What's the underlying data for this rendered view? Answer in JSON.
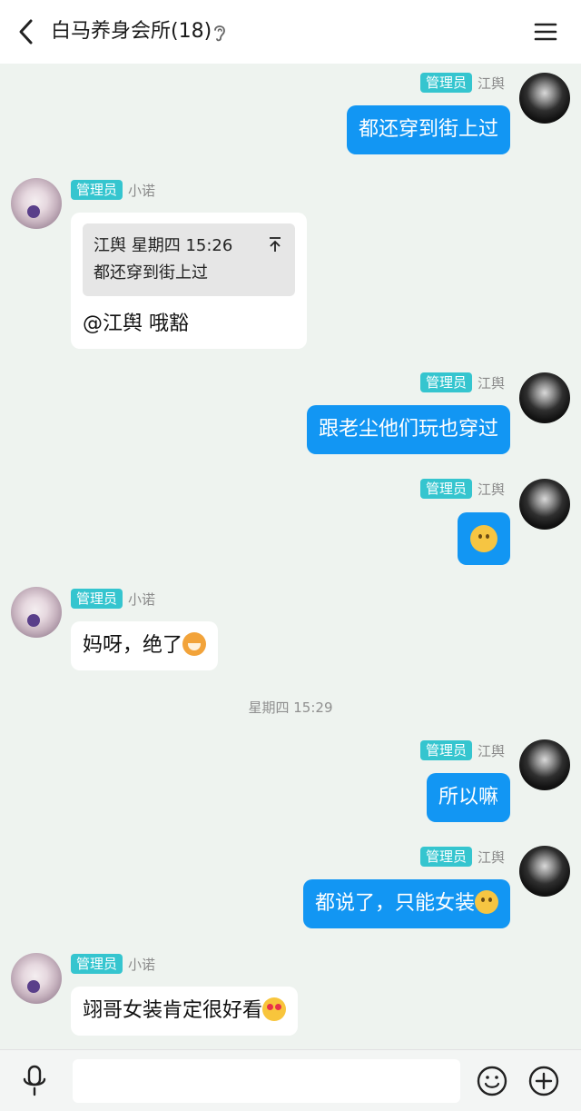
{
  "header": {
    "title": "白马养身会所(18)",
    "back_icon": "chevron-left-icon",
    "ear_icon": "ear-icon",
    "menu_icon": "hamburger-menu-icon"
  },
  "messages": [
    {
      "side": "right",
      "badge": "管理员",
      "name": "江舆",
      "text": "都还穿到街上过"
    },
    {
      "side": "left",
      "badge": "管理员",
      "name": "小诺",
      "quote_header": "江舆 星期四 15:26",
      "quote_text": "都还穿到街上过",
      "text": "@江舆 哦豁"
    },
    {
      "side": "right",
      "badge": "管理员",
      "name": "江舆",
      "text": "跟老尘他们玩也穿过"
    },
    {
      "side": "right",
      "badge": "管理员",
      "name": "江舆",
      "emoji": "smiling-face-emoji"
    },
    {
      "side": "left",
      "badge": "管理员",
      "name": "小诺",
      "text": "妈呀，绝了",
      "emoji": "dog-face-emoji"
    },
    {
      "side": "right",
      "badge": "管理员",
      "name": "江舆",
      "text": "所以嘛"
    },
    {
      "side": "right",
      "badge": "管理员",
      "name": "江舆",
      "text": "都说了，只能女装",
      "emoji": "smiling-face-emoji"
    },
    {
      "side": "left",
      "badge": "管理员",
      "name": "小诺",
      "text": "翊哥女装肯定很好看",
      "emoji": "heart-eyes-emoji"
    }
  ],
  "timestamp": "星期四 15:29",
  "bottom_bar": {
    "input_value": "",
    "mic_icon": "microphone-icon",
    "emoji_icon": "emoji-icon",
    "plus_icon": "plus-icon"
  },
  "colors": {
    "background": "#eef3ef",
    "bubble_sent": "#1296f3",
    "bubble_received": "#ffffff",
    "admin_badge": "#35c5cf"
  }
}
